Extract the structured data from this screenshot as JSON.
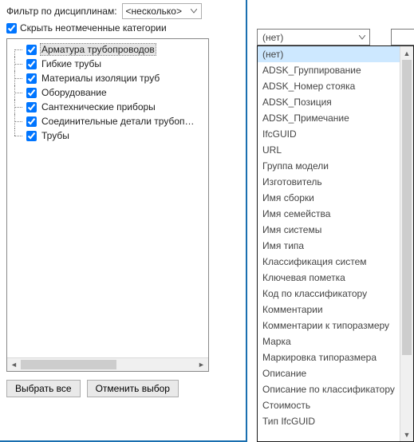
{
  "filter": {
    "label": "Фильтр по дисциплинам:",
    "combo_value": "<несколько>"
  },
  "hide_unchecked": {
    "label": "Скрыть неотмеченные категории",
    "checked": true
  },
  "tree": {
    "items": [
      {
        "label": "Арматура трубопроводов",
        "checked": true,
        "selected": true
      },
      {
        "label": "Гибкие трубы",
        "checked": true,
        "selected": false
      },
      {
        "label": "Материалы изоляции труб",
        "checked": true,
        "selected": false
      },
      {
        "label": "Оборудование",
        "checked": true,
        "selected": false
      },
      {
        "label": "Сантехнические приборы",
        "checked": true,
        "selected": false
      },
      {
        "label": "Соединительные детали трубопрово…",
        "checked": true,
        "selected": false
      },
      {
        "label": "Трубы",
        "checked": true,
        "selected": false
      }
    ]
  },
  "buttons": {
    "select_all": "Выбрать все",
    "deselect_all": "Отменить выбор"
  },
  "dropdown": {
    "selected": "(нет)",
    "options": [
      "(нет)",
      "ADSK_Группирование",
      "ADSK_Номер стояка",
      "ADSK_Позиция",
      "ADSK_Примечание",
      "IfcGUID",
      "URL",
      "Группа модели",
      "Изготовитель",
      "Имя сборки",
      "Имя семейства",
      "Имя системы",
      "Имя типа",
      "Классификация систем",
      "Ключевая пометка",
      "Код по классификатору",
      "Комментарии",
      "Комментарии к типоразмеру",
      "Марка",
      "Маркировка типоразмера",
      "Описание",
      "Описание по классификатору",
      "Стоимость",
      "Тип IfcGUID"
    ],
    "highlight_index": 0
  }
}
